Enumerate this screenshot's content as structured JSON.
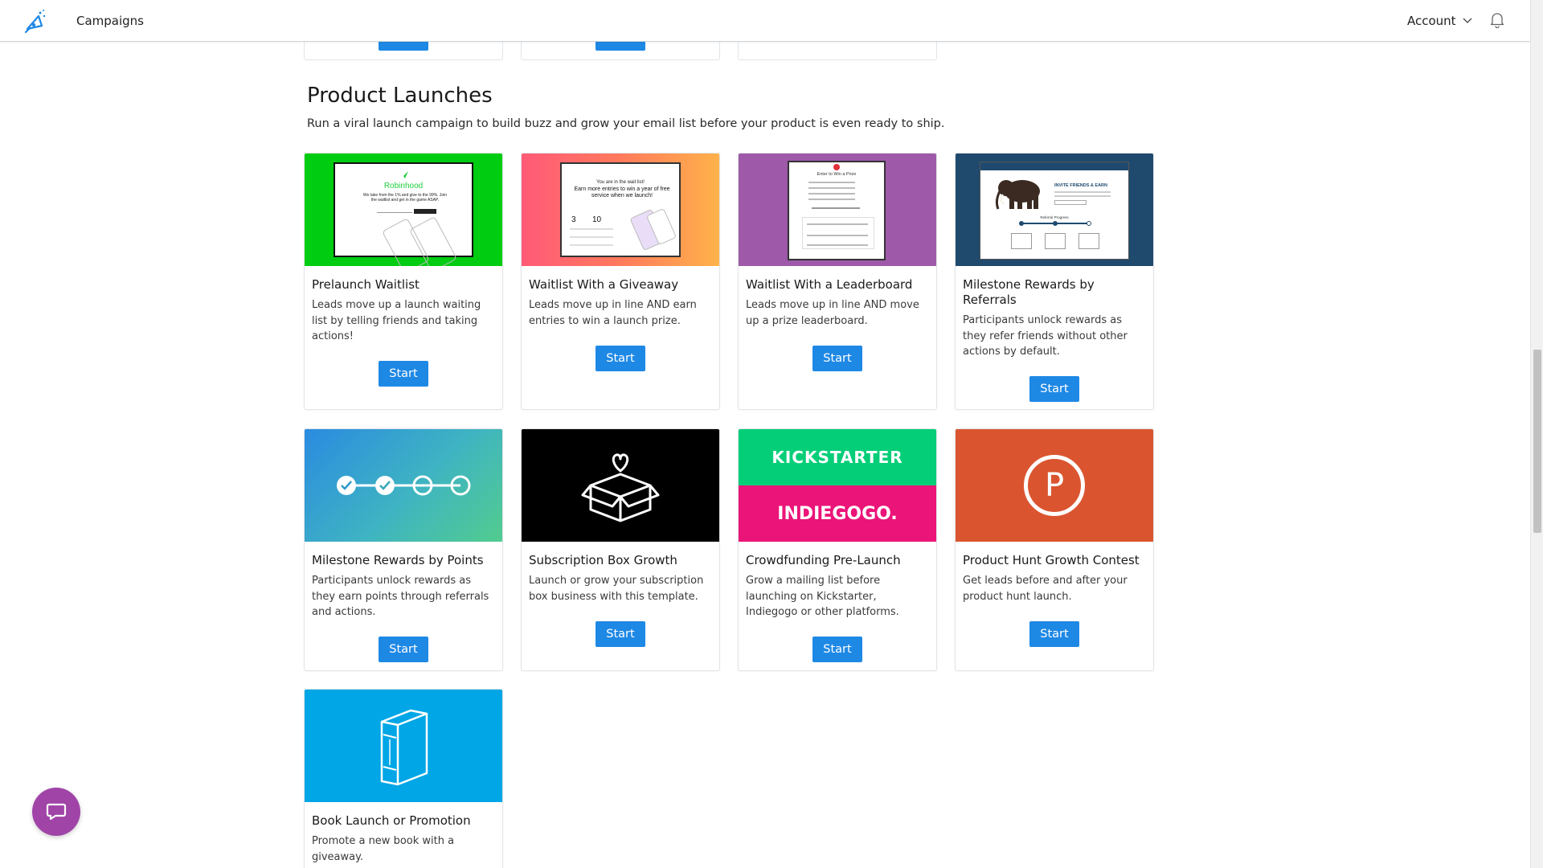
{
  "nav": {
    "campaigns_label": "Campaigns",
    "account_label": "Account"
  },
  "section": {
    "title": "Product Launches",
    "description": "Run a viral launch campaign to build buzz and grow your email list before your product is even ready to ship."
  },
  "cards": [
    {
      "title": "Prelaunch Waitlist",
      "description": "Leads move up a launch waiting list by telling friends and taking actions!",
      "button": "Start",
      "image_brand": "Robinhood"
    },
    {
      "title": "Waitlist With a Giveaway",
      "description": "Leads move up in line AND earn entries to win a launch prize.",
      "button": "Start"
    },
    {
      "title": "Waitlist With a Leaderboard",
      "description": "Leads move up in line AND move up a prize leaderboard.",
      "button": "Start"
    },
    {
      "title": "Milestone Rewards by Referrals",
      "description": "Participants unlock rewards as they refer friends without other actions by default.",
      "button": "Start"
    },
    {
      "title": "Milestone Rewards by Points",
      "description": "Participants unlock rewards as they earn points through referrals and actions.",
      "button": "Start"
    },
    {
      "title": "Subscription Box Growth",
      "description": "Launch or grow your subscription box business with this template.",
      "button": "Start"
    },
    {
      "title": "Crowdfunding Pre-Launch",
      "description": "Grow a mailing list before launching on Kickstarter, Indiegogo or other platforms.",
      "button": "Start",
      "image_top": "KICKSTARTER",
      "image_bottom": "INDIEGOGO."
    },
    {
      "title": "Product Hunt Growth Contest",
      "description": "Get leads before and after your product hunt launch.",
      "button": "Start",
      "image_letter": "P"
    },
    {
      "title": "Book Launch or Promotion",
      "description": "Promote a new book with a giveaway."
    }
  ],
  "image_texts": {
    "giveaway_line1": "You are in the wait list!",
    "giveaway_line2": "Earn more entries to win a year of free service when we launch!",
    "giveaway_stat1": "3",
    "giveaway_stat2": "10",
    "robinhood_tagline": "We take from the 1% and give to the 99%. Join the waitlist and get in the game ASAP.",
    "leaderboard_heading": "Enter to Win a Prize",
    "milestone_heading": "INVITE FRIENDS & EARN",
    "milestone_progress": "Referral Progress"
  },
  "colors": {
    "primary_button": "#1e88e5",
    "card1_bg": "#00cc11",
    "card3_bg": "#9e59a9",
    "card4_bg": "#1f4a6e",
    "card6_bg": "#000000",
    "kickstarter": "#05ce78",
    "indiegogo": "#eb1478",
    "producthunt": "#da552f",
    "book_bg": "#00a6e6",
    "chat_bubble": "#a044a8"
  }
}
